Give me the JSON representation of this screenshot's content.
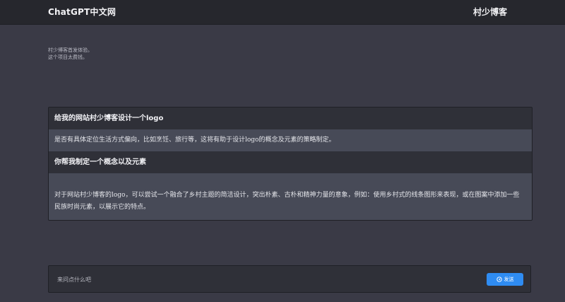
{
  "header": {
    "brand": "ChatGPT中文网",
    "site_name": "村少博客"
  },
  "intro": {
    "line1": "村少博客首发体验。",
    "line2": "这个项目太费钱。"
  },
  "conversation": [
    {
      "role": "user",
      "text": "给我的网站村少博客设计一个logo"
    },
    {
      "role": "assistant",
      "text": "是否有具体定位生活方式偏向，比如烹饪、旅行等，这将有助于设计logo的概念及元素的策略制定。"
    },
    {
      "role": "user",
      "text": "你帮我制定一个概念以及元素"
    },
    {
      "role": "assistant",
      "text": "对于网站村少博客的logo，可以尝试一个融合了乡村主题的简洁设计，突出朴素、古朴和精神力量的意象，例如：使用乡村式的线条图形来表现，或在图案中添加一些民族时尚元素，以展示它的特点。"
    }
  ],
  "composer": {
    "placeholder": "来问点什么吧",
    "value": "",
    "send_label": "发送",
    "send_icon": "send-icon"
  },
  "colors": {
    "background": "#3a3a46",
    "header": "#26272d",
    "panel": "#2f3038",
    "answer_row": "#474a57",
    "accent": "#2f8cf2"
  }
}
